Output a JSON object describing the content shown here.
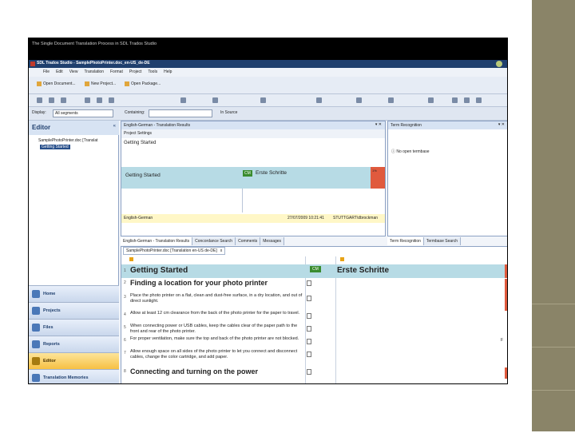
{
  "screen_caption": "The Single Document Translation Process in SDL Trados Studio",
  "window": {
    "title": "SDL Trados Studio - SamplePhotoPrinter.doc_en-US_de-DE"
  },
  "menu": [
    "File",
    "Edit",
    "View",
    "Translation",
    "Format",
    "Project",
    "Tools",
    "Help"
  ],
  "toolbar": {
    "open_document": "Open Document...",
    "new_project": "New Project...",
    "open_package": "Open Package..."
  },
  "filter": {
    "display_label": "Display:",
    "display_value": "All segments",
    "containing_label": "Containing:",
    "in_source": "In Source"
  },
  "editor": {
    "title": "Editor",
    "tree_file": "SamplePhotoPrinter.doc [Translat",
    "tree_selected": "Getting Started"
  },
  "nav": [
    {
      "label": "Home"
    },
    {
      "label": "Projects"
    },
    {
      "label": "Files"
    },
    {
      "label": "Reports"
    },
    {
      "label": "Editor"
    },
    {
      "label": "Translation Memories"
    }
  ],
  "tm_pane": {
    "header": "English-German - Translation Results",
    "project_settings": "Project Settings",
    "source": "Getting Started",
    "match_source": "Getting Started",
    "match_badge": "CM",
    "match_target": "Erste Schritte",
    "match_percent": "1%",
    "langpair": "English-German",
    "date": "27/07/2009 10:21:41",
    "user": "STUTTGART\\dbrockman"
  },
  "tm_tabs": [
    "English-German - Translation Results",
    "Concordance Search",
    "Comments",
    "Messages"
  ],
  "term_pane": {
    "header": "Term Recognition",
    "message": "No open termbase"
  },
  "term_tabs": [
    "Term Recognition",
    "Termbase Search"
  ],
  "editor_tab": {
    "label": "SamplePhotoPrinter.doc [Translation en-US de-DE]",
    "close": "x"
  },
  "segments": [
    {
      "n": "1",
      "source": "Getting Started",
      "status": "CM",
      "target": "Erste Schritte"
    },
    {
      "n": "2",
      "source": "Finding a location for your photo printer"
    },
    {
      "n": "3",
      "source": "Place the photo printer on a flat, clean and dust-free surface, in a dry location, and out of direct sunlight."
    },
    {
      "n": "4",
      "source": "Allow at least 12 cm clearance from the back of the photo printer for the paper to travel."
    },
    {
      "n": "5",
      "source": "When connecting power or USB cables, keep the cables clear of the paper path to the front and rear of the photo printer."
    },
    {
      "n": "6",
      "source": "For proper ventilation, make sure the top and back of the photo printer are not blocked."
    },
    {
      "n": "7",
      "source": "Allow enough space on all sides of the photo printer to let you connect and disconnect cables, change the color cartridge, and add paper."
    },
    {
      "n": "8",
      "source": "Connecting and turning on the power"
    }
  ],
  "right_marker": "F",
  "colors": {
    "accent": "#1f3f6e",
    "match_bg": "#b7dbe5",
    "status_bar": "#e05a3d",
    "slide_bar": "#8a8468"
  }
}
